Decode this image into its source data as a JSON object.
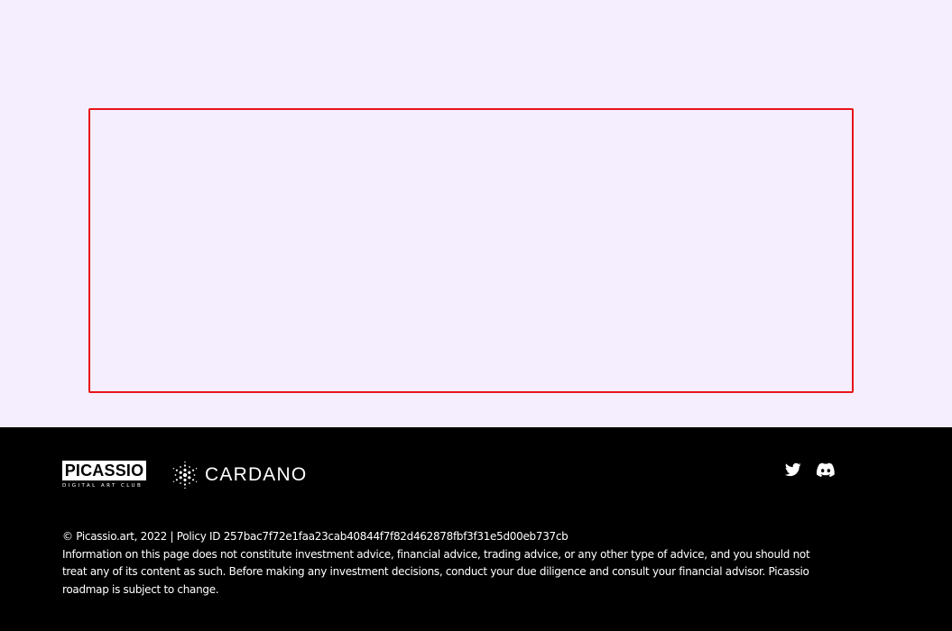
{
  "page": {
    "background_color": "#f4eefe",
    "frame_color": "#e8131b"
  },
  "footer": {
    "background_color": "#000000",
    "brand": {
      "wordmark": "PICASSIO",
      "tagline": "DIGITAL ART CLUB"
    },
    "partner": {
      "name": "CARDANO",
      "icon": "cardano-logo-icon"
    },
    "socials": [
      {
        "name": "Twitter",
        "icon": "twitter-icon"
      },
      {
        "name": "Discord",
        "icon": "discord-icon"
      }
    ],
    "copyright": "© Picassio.art, 2022 | Policy ID 257bac7f72e1faa23cab40844f7f82d462878fbf3f31e5d00eb737cb",
    "disclaimer": "Information on this page does not constitute investment advice, financial advice, trading advice, or any other type of advice, and you should not treat any of its content as such. Before making any investment decisions, conduct your due diligence and consult your financial advisor. Picassio roadmap is subject to change."
  }
}
